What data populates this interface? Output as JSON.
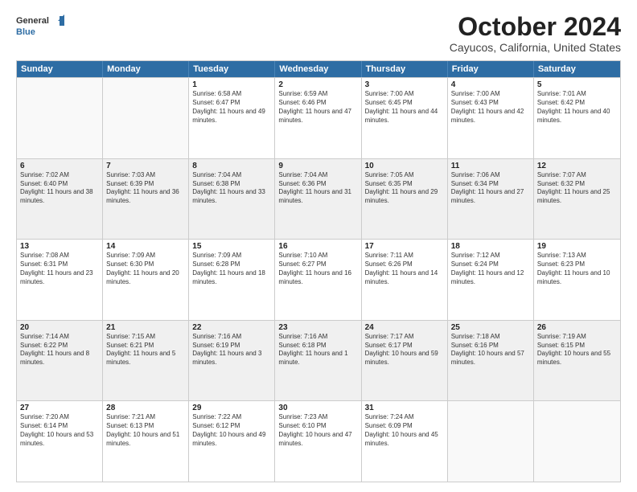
{
  "logo": {
    "line1": "General",
    "line2": "Blue"
  },
  "title": "October 2024",
  "subtitle": "Cayucos, California, United States",
  "header_days": [
    "Sunday",
    "Monday",
    "Tuesday",
    "Wednesday",
    "Thursday",
    "Friday",
    "Saturday"
  ],
  "weeks": [
    [
      {
        "day": "",
        "content": ""
      },
      {
        "day": "",
        "content": ""
      },
      {
        "day": "1",
        "content": "Sunrise: 6:58 AM\nSunset: 6:47 PM\nDaylight: 11 hours and 49 minutes."
      },
      {
        "day": "2",
        "content": "Sunrise: 6:59 AM\nSunset: 6:46 PM\nDaylight: 11 hours and 47 minutes."
      },
      {
        "day": "3",
        "content": "Sunrise: 7:00 AM\nSunset: 6:45 PM\nDaylight: 11 hours and 44 minutes."
      },
      {
        "day": "4",
        "content": "Sunrise: 7:00 AM\nSunset: 6:43 PM\nDaylight: 11 hours and 42 minutes."
      },
      {
        "day": "5",
        "content": "Sunrise: 7:01 AM\nSunset: 6:42 PM\nDaylight: 11 hours and 40 minutes."
      }
    ],
    [
      {
        "day": "6",
        "content": "Sunrise: 7:02 AM\nSunset: 6:40 PM\nDaylight: 11 hours and 38 minutes."
      },
      {
        "day": "7",
        "content": "Sunrise: 7:03 AM\nSunset: 6:39 PM\nDaylight: 11 hours and 36 minutes."
      },
      {
        "day": "8",
        "content": "Sunrise: 7:04 AM\nSunset: 6:38 PM\nDaylight: 11 hours and 33 minutes."
      },
      {
        "day": "9",
        "content": "Sunrise: 7:04 AM\nSunset: 6:36 PM\nDaylight: 11 hours and 31 minutes."
      },
      {
        "day": "10",
        "content": "Sunrise: 7:05 AM\nSunset: 6:35 PM\nDaylight: 11 hours and 29 minutes."
      },
      {
        "day": "11",
        "content": "Sunrise: 7:06 AM\nSunset: 6:34 PM\nDaylight: 11 hours and 27 minutes."
      },
      {
        "day": "12",
        "content": "Sunrise: 7:07 AM\nSunset: 6:32 PM\nDaylight: 11 hours and 25 minutes."
      }
    ],
    [
      {
        "day": "13",
        "content": "Sunrise: 7:08 AM\nSunset: 6:31 PM\nDaylight: 11 hours and 23 minutes."
      },
      {
        "day": "14",
        "content": "Sunrise: 7:09 AM\nSunset: 6:30 PM\nDaylight: 11 hours and 20 minutes."
      },
      {
        "day": "15",
        "content": "Sunrise: 7:09 AM\nSunset: 6:28 PM\nDaylight: 11 hours and 18 minutes."
      },
      {
        "day": "16",
        "content": "Sunrise: 7:10 AM\nSunset: 6:27 PM\nDaylight: 11 hours and 16 minutes."
      },
      {
        "day": "17",
        "content": "Sunrise: 7:11 AM\nSunset: 6:26 PM\nDaylight: 11 hours and 14 minutes."
      },
      {
        "day": "18",
        "content": "Sunrise: 7:12 AM\nSunset: 6:24 PM\nDaylight: 11 hours and 12 minutes."
      },
      {
        "day": "19",
        "content": "Sunrise: 7:13 AM\nSunset: 6:23 PM\nDaylight: 11 hours and 10 minutes."
      }
    ],
    [
      {
        "day": "20",
        "content": "Sunrise: 7:14 AM\nSunset: 6:22 PM\nDaylight: 11 hours and 8 minutes."
      },
      {
        "day": "21",
        "content": "Sunrise: 7:15 AM\nSunset: 6:21 PM\nDaylight: 11 hours and 5 minutes."
      },
      {
        "day": "22",
        "content": "Sunrise: 7:16 AM\nSunset: 6:19 PM\nDaylight: 11 hours and 3 minutes."
      },
      {
        "day": "23",
        "content": "Sunrise: 7:16 AM\nSunset: 6:18 PM\nDaylight: 11 hours and 1 minute."
      },
      {
        "day": "24",
        "content": "Sunrise: 7:17 AM\nSunset: 6:17 PM\nDaylight: 10 hours and 59 minutes."
      },
      {
        "day": "25",
        "content": "Sunrise: 7:18 AM\nSunset: 6:16 PM\nDaylight: 10 hours and 57 minutes."
      },
      {
        "day": "26",
        "content": "Sunrise: 7:19 AM\nSunset: 6:15 PM\nDaylight: 10 hours and 55 minutes."
      }
    ],
    [
      {
        "day": "27",
        "content": "Sunrise: 7:20 AM\nSunset: 6:14 PM\nDaylight: 10 hours and 53 minutes."
      },
      {
        "day": "28",
        "content": "Sunrise: 7:21 AM\nSunset: 6:13 PM\nDaylight: 10 hours and 51 minutes."
      },
      {
        "day": "29",
        "content": "Sunrise: 7:22 AM\nSunset: 6:12 PM\nDaylight: 10 hours and 49 minutes."
      },
      {
        "day": "30",
        "content": "Sunrise: 7:23 AM\nSunset: 6:10 PM\nDaylight: 10 hours and 47 minutes."
      },
      {
        "day": "31",
        "content": "Sunrise: 7:24 AM\nSunset: 6:09 PM\nDaylight: 10 hours and 45 minutes."
      },
      {
        "day": "",
        "content": ""
      },
      {
        "day": "",
        "content": ""
      }
    ]
  ]
}
